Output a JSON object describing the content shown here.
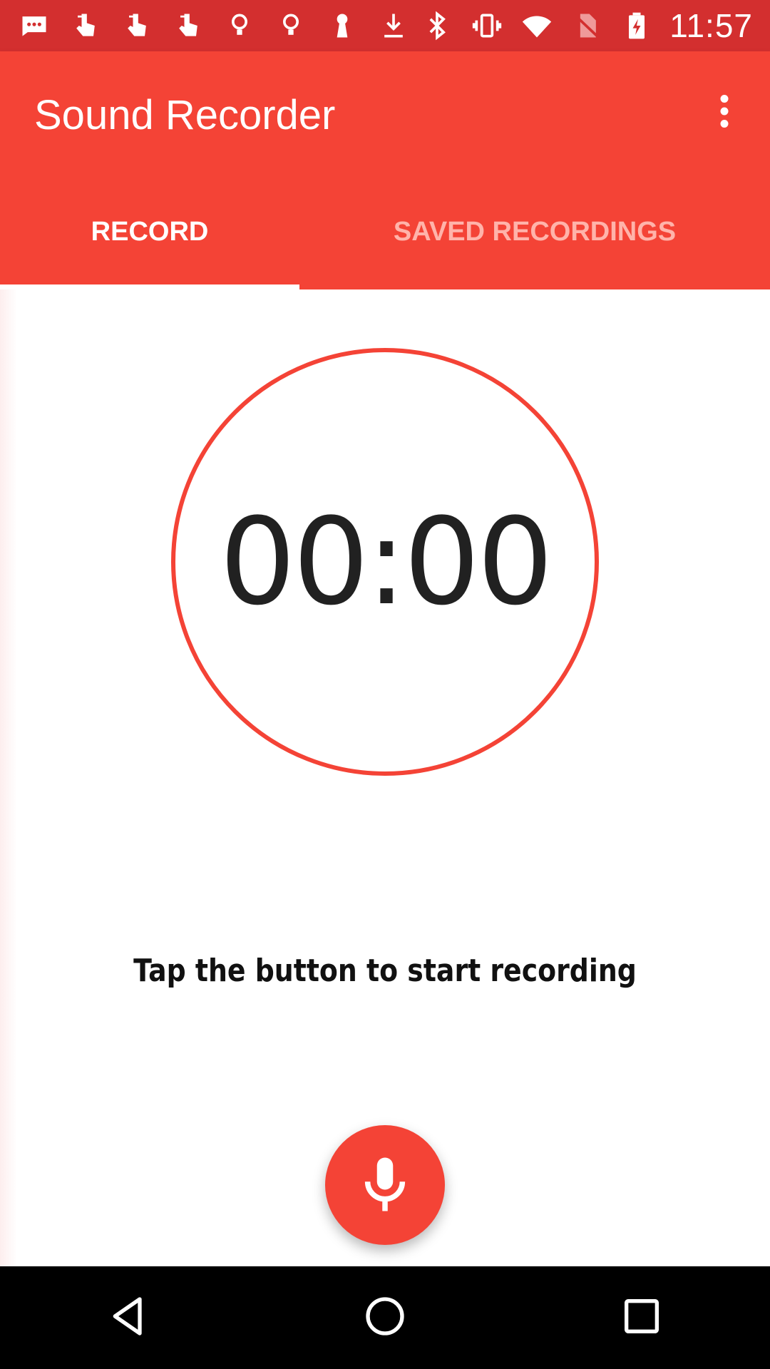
{
  "status_bar": {
    "time": "11:57",
    "left_icons": [
      "message-icon",
      "touch-icon",
      "touch-icon",
      "touch-icon",
      "bulb-icon",
      "bulb-icon",
      "keyhole-icon",
      "download-icon"
    ],
    "right_icons": [
      "bluetooth-icon",
      "vibrate-icon",
      "wifi-icon",
      "no-sim-icon",
      "battery-charging-icon"
    ]
  },
  "app_bar": {
    "title": "Sound Recorder",
    "menu_icon": "more-vert-icon"
  },
  "tabs": [
    {
      "label": "RECORD",
      "selected": true
    },
    {
      "label": "SAVED RECORDINGS",
      "selected": false
    }
  ],
  "recorder": {
    "timer": "00:00",
    "hint": "Tap the button to start recording",
    "button_icon": "microphone-icon"
  },
  "colors": {
    "status_bar": "#d32f2f",
    "primary": "#f44336",
    "tab_inactive": "#ffb3aa"
  },
  "nav_bar": {
    "icons": [
      "back-icon",
      "home-icon",
      "recents-icon"
    ]
  }
}
